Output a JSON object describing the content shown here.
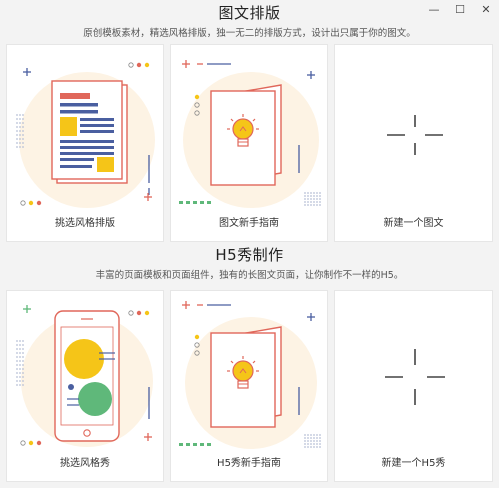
{
  "window": {
    "controls": {
      "minimize": "—",
      "maximize": "☐",
      "close": "✕"
    }
  },
  "graphic_section": {
    "title": "图文排版",
    "subtitle": "原创模板素材，精选风格排版，独一无二的排版方式，设计出只属于你的图文。",
    "cards": [
      {
        "label": "挑选风格排版",
        "icon": "document-template-icon"
      },
      {
        "label": "图文新手指南",
        "icon": "guide-book-icon"
      },
      {
        "label": "新建一个图文",
        "icon": "plus-icon"
      }
    ]
  },
  "h5_section": {
    "title": "H5秀制作",
    "subtitle": "丰富的页面模板和页面组件，独有的长图文页面，让你制作不一样的H5。",
    "cards": [
      {
        "label": "挑选风格秀",
        "icon": "phone-template-icon"
      },
      {
        "label": "H5秀新手指南",
        "icon": "guide-book-icon"
      },
      {
        "label": "新建一个H5秀",
        "icon": "plus-icon"
      }
    ]
  },
  "colors": {
    "accent_red": "#e0675a",
    "accent_yellow": "#f5c518",
    "accent_blue": "#4a5fa0",
    "accent_green": "#5fb87a",
    "circle_bg": "#fdf3e4"
  }
}
